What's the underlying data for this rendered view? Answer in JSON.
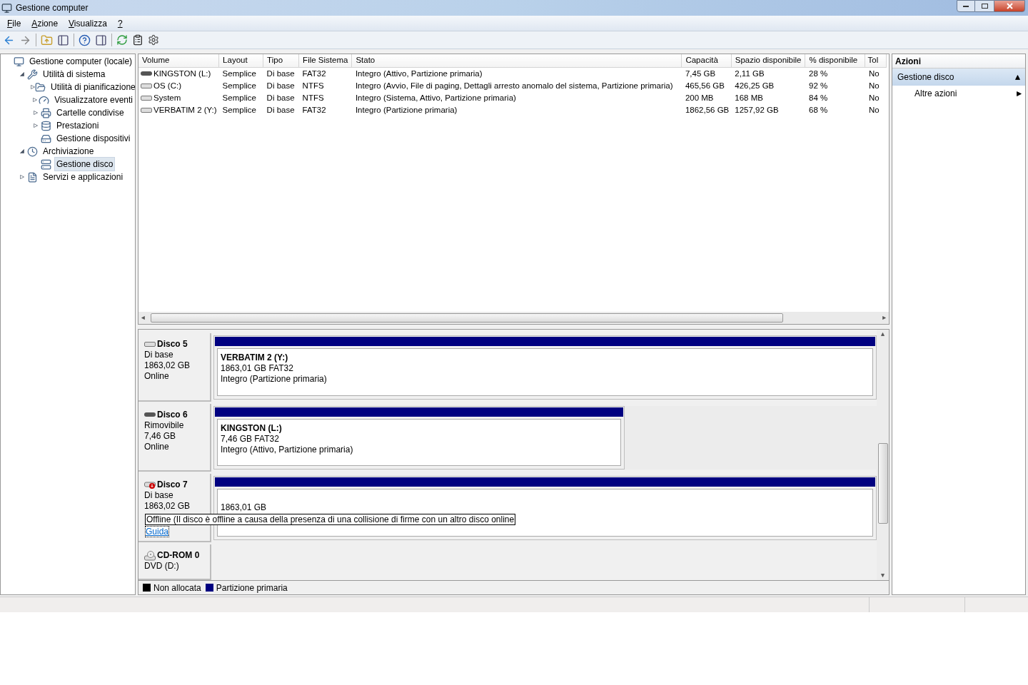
{
  "window": {
    "title": "Gestione computer"
  },
  "menu": [
    "File",
    "Azione",
    "Visualizza",
    "?"
  ],
  "tree": [
    {
      "label": "Gestione computer (locale)",
      "selected": false,
      "children": [
        {
          "label": "Utilità di sistema",
          "selected": false,
          "expanded": true,
          "children": [
            {
              "label": "Utilità di pianificazione",
              "selected": false,
              "expanded": false
            },
            {
              "label": "Visualizzatore eventi",
              "selected": false,
              "expanded": false
            },
            {
              "label": "Cartelle condivise",
              "selected": false,
              "expanded": false
            },
            {
              "label": "Prestazioni",
              "selected": false,
              "expanded": false
            },
            {
              "label": "Gestione dispositivi",
              "selected": false
            }
          ]
        },
        {
          "label": "Archiviazione",
          "selected": false,
          "expanded": true,
          "children": [
            {
              "label": "Gestione disco",
              "selected": true
            }
          ]
        },
        {
          "label": "Servizi e applicazioni",
          "selected": false,
          "expanded": false
        }
      ]
    }
  ],
  "table": {
    "columns": [
      "Volume",
      "Layout",
      "Tipo",
      "File Sistema",
      "Stato",
      "Capacità",
      "Spazio disponibile",
      "% disponibile",
      "Tol"
    ],
    "rows": [
      {
        "kind": "removable",
        "cells": [
          "KINGSTON (L:)",
          "Semplice",
          "Di base",
          "FAT32",
          "Integro (Attivo, Partizione primaria)",
          "7,45 GB",
          "2,11 GB",
          "28 %",
          "No"
        ]
      },
      {
        "kind": "fixed",
        "cells": [
          "OS (C:)",
          "Semplice",
          "Di base",
          "NTFS",
          "Integro (Avvio, File di paging, Dettagli arresto anomalo del sistema, Partizione primaria)",
          "465,56 GB",
          "426,25 GB",
          "92 %",
          "No"
        ]
      },
      {
        "kind": "fixed",
        "cells": [
          "System",
          "Semplice",
          "Di base",
          "NTFS",
          "Integro (Sistema, Attivo, Partizione primaria)",
          "200 MB",
          "168 MB",
          "84 %",
          "No"
        ]
      },
      {
        "kind": "fixed",
        "cells": [
          "VERBATIM 2 (Y:)",
          "Semplice",
          "Di base",
          "FAT32",
          "Integro (Partizione primaria)",
          "1862,56 GB",
          "1257,92 GB",
          "68 %",
          "No"
        ]
      }
    ]
  },
  "disks": [
    {
      "kind": "disk",
      "name": "Disco 5",
      "lines": [
        "Di base",
        "1863,02 GB",
        "Online"
      ],
      "partition": {
        "level": 1,
        "title": "VERBATIM 2  (Y:)",
        "lines": [
          "1863,01 GB FAT32",
          "Integro (Partizione primaria)"
        ]
      }
    },
    {
      "kind": "removable",
      "name": "Disco 6",
      "lines": [
        "Rimovibile",
        "7,46 GB",
        "Online"
      ],
      "partition": {
        "level": 0.62,
        "title": "KINGSTON  (L:)",
        "lines": [
          "7,46 GB FAT32",
          "Integro (Attivo, Partizione primaria)"
        ]
      }
    },
    {
      "kind": "offline",
      "name": "Disco 7",
      "lines": [
        "Di base",
        "1863,02 GB"
      ],
      "partition": {
        "level": 1,
        "lines": [
          "1863,01 GB"
        ]
      },
      "tooltip": "Offline (Il disco è offline a causa della presenza di una collisione di firme con un altro disco online",
      "link": "Guida"
    },
    {
      "kind": "cdrom",
      "name": "CD-ROM 0",
      "lines": [
        "DVD (D:)"
      ]
    }
  ],
  "legend": [
    {
      "label": "Non allocata",
      "color": "#000000"
    },
    {
      "label": "Partizione primaria",
      "color": "#000080"
    }
  ],
  "actions": {
    "title": "Azioni",
    "section": {
      "label": "Gestione disco",
      "expanded": true
    },
    "items": [
      "Altre azioni"
    ]
  }
}
